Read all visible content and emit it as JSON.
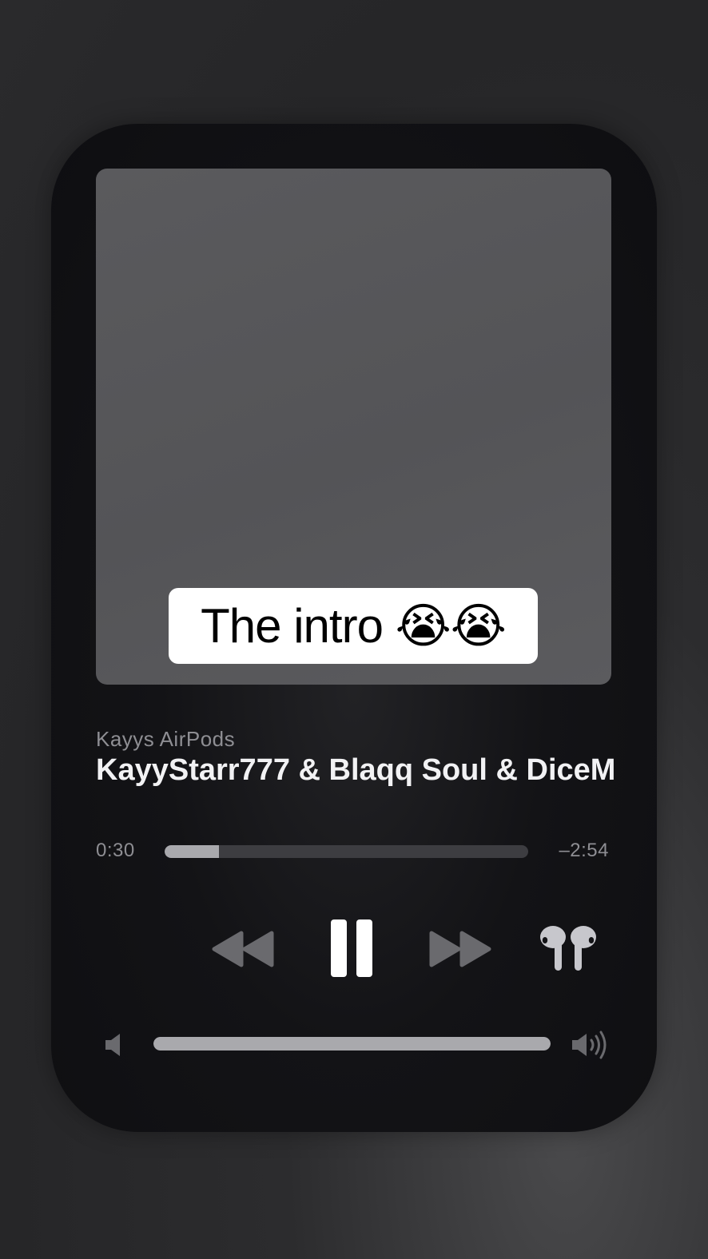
{
  "caption": {
    "text": "The intro 😭😭"
  },
  "now_playing": {
    "device": "Kayys AirPods",
    "title": "KayyStarr777 & Blaqq Soul & DiceM",
    "time_elapsed": "0:30",
    "time_remaining": "–2:54",
    "progress": 0.15
  },
  "controls": {
    "rewind_icon": "rewind-icon",
    "pause_icon": "pause-icon",
    "forward_icon": "fast-forward-icon",
    "output_icon": "airpods-icon"
  },
  "volume": {
    "level": 1.0,
    "low_icon": "speaker-low-icon",
    "high_icon": "speaker-high-icon"
  },
  "colors": {
    "card_background": "#0e0e11",
    "artwork_placeholder": "#555558",
    "progress_fill": "#a9a9ad",
    "progress_track": "#3d3d41",
    "title_text": "#f2f2f4",
    "secondary_text": "#8e8e93"
  }
}
